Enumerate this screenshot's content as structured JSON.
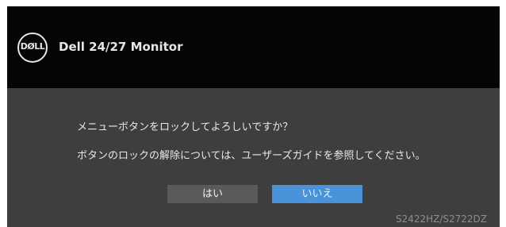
{
  "header": {
    "logo_text": "DØLL",
    "title": "Dell 24/27 Monitor"
  },
  "dialog": {
    "message_line1": "メニューボタンをロックしてよろしいですか？",
    "message_line2": "ボタンのロックの解除については、ユーザーズガイドを参照してください。",
    "yes_label": "はい",
    "no_label": "いいえ",
    "selected_button": "いいえ"
  },
  "footer": {
    "model_text": "S2422HZ/S2722DZ"
  },
  "colors": {
    "header_bg": "#050505",
    "body_bg": "#3e3e3e",
    "button_inactive": "#5a5a5a",
    "button_selected": "#4a92d9"
  }
}
